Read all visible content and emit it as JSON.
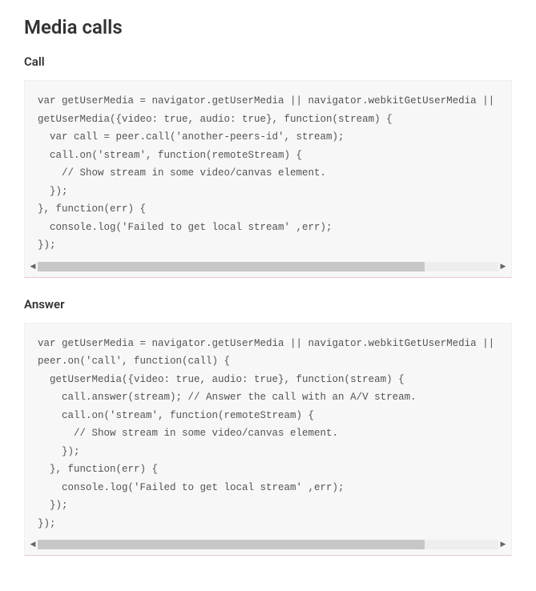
{
  "headings": {
    "main": "Media calls",
    "call": "Call",
    "answer": "Answer"
  },
  "code": {
    "call": "var getUserMedia = navigator.getUserMedia || navigator.webkitGetUserMedia || navigator.m\ngetUserMedia({video: true, audio: true}, function(stream) {\n  var call = peer.call('another-peers-id', stream);\n  call.on('stream', function(remoteStream) {\n    // Show stream in some video/canvas element.\n  });\n}, function(err) {\n  console.log('Failed to get local stream' ,err);\n});",
    "answer": "var getUserMedia = navigator.getUserMedia || navigator.webkitGetUserMedia || navigator.m\npeer.on('call', function(call) {\n  getUserMedia({video: true, audio: true}, function(stream) {\n    call.answer(stream); // Answer the call with an A/V stream.\n    call.on('stream', function(remoteStream) {\n      // Show stream in some video/canvas element.\n    });\n  }, function(err) {\n    console.log('Failed to get local stream' ,err);\n  });\n});"
  }
}
